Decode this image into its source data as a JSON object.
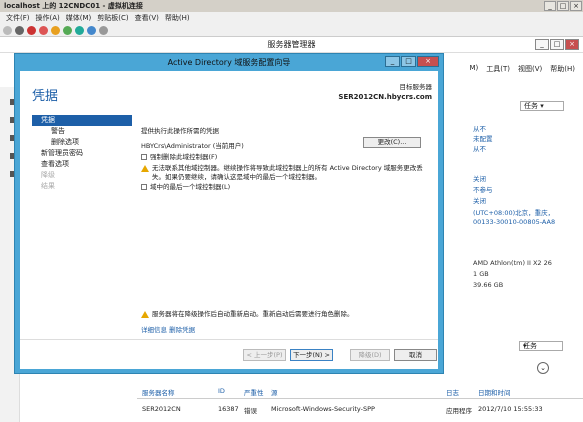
{
  "vm": {
    "title": "localhost 上的 12CNDC01 - 虚拟机连接",
    "menu": [
      "文件(F)",
      "操作(A)",
      "媒体(M)",
      "剪贴板(C)",
      "查看(V)",
      "帮助(H)"
    ]
  },
  "server_manager": {
    "title": "服务器管理器",
    "menus": [
      "M)",
      "工具(T)",
      "视图(V)",
      "帮助(H)"
    ],
    "tasks_label": "任务",
    "properties": [
      "从不",
      "未配置",
      "从不",
      "关闭",
      "不参与",
      "关闭",
      "(UTC+08:00)北京，重庆，",
      "00133-30010-00805-AA8",
      "AMD Athlon(tm) II X2 26",
      "1 GB",
      "39.66 GB"
    ],
    "events": {
      "tasks_label": "任务",
      "headers": [
        "服务器名称",
        "ID",
        "严重性",
        "源",
        "日志",
        "日期和时间"
      ],
      "row": [
        "SER2012CN",
        "16387",
        "错误",
        "Microsoft-Windows-Security-SPP",
        "应用程序",
        "2012/7/10 15:55:33"
      ]
    }
  },
  "wizard": {
    "title": "Active Directory 域服务配置向导",
    "heading": "凭据",
    "target_label": "目标服务器",
    "target_server": "SER2012CN.hbycrs.com",
    "steps": [
      {
        "label": "凭据",
        "state": "active"
      },
      {
        "label": "警告",
        "state": "sub"
      },
      {
        "label": "删除选项",
        "state": "sub"
      },
      {
        "label": "新管理员密码",
        "state": "normal"
      },
      {
        "label": "查看选项",
        "state": "normal"
      },
      {
        "label": "降级",
        "state": "disabled"
      },
      {
        "label": "结果",
        "state": "disabled"
      }
    ],
    "credentials_label": "提供执行此操作所需的凭据",
    "current_user": "HBYCrs\\Administrator (当前用户)",
    "change_button": "更改(C)...",
    "force_remove_label": "强制删除此域控制器(F)",
    "warning_line1": "无法联系其他域控制器。继续操作将导致此域控制器上的所有 Active Directory 域服务更改丢",
    "warning_line2": "失。如果仍要继续，请确认这是域中的最后一个域控制器。",
    "last_dc_label": "域中的最后一个域控制器(L)",
    "restart_warning": "服务器将在降级操作后自动重新启动。重新启动后需要进行角色删除。",
    "more_info": "详细信息 删除凭据",
    "buttons": {
      "prev": "< 上一步(P)",
      "next": "下一步(N) >",
      "demote": "降级(D)",
      "cancel": "取消"
    }
  },
  "colors": {
    "accent": "#1d5fa8",
    "wizard_frame": "#4aa6d6",
    "warning": "#e6a700"
  }
}
